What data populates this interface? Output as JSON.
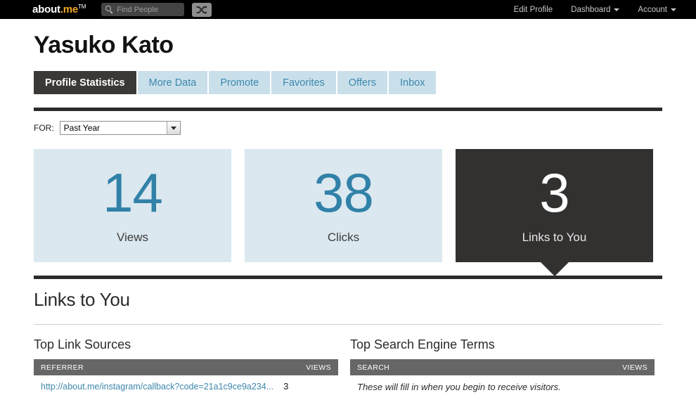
{
  "topbar": {
    "brand_name": "about",
    "brand_suffix": ".me",
    "brand_tm": "TM",
    "search_placeholder": "Find People",
    "shuffle_icon": "shuffle-icon",
    "nav": [
      {
        "label": "Edit Profile",
        "has_caret": false
      },
      {
        "label": "Dashboard",
        "has_caret": true
      },
      {
        "label": "Account",
        "has_caret": true
      }
    ]
  },
  "profile": {
    "name": "Yasuko Kato"
  },
  "tabs": [
    {
      "label": "Profile Statistics",
      "active": true
    },
    {
      "label": "More Data",
      "active": false
    },
    {
      "label": "Promote",
      "active": false
    },
    {
      "label": "Favorites",
      "active": false
    },
    {
      "label": "Offers",
      "active": false
    },
    {
      "label": "Inbox",
      "active": false
    }
  ],
  "filter": {
    "label": "FOR:",
    "selected": "Past Year",
    "options": [
      "Past Year"
    ]
  },
  "stats": [
    {
      "value": "14",
      "label": "Views",
      "theme": "light"
    },
    {
      "value": "38",
      "label": "Clicks",
      "theme": "light"
    },
    {
      "value": "3",
      "label": "Links to You",
      "theme": "dark"
    }
  ],
  "section": {
    "title": "Links to You"
  },
  "top_link_sources": {
    "title": "Top Link Sources",
    "columns": [
      "REFERRER",
      "VIEWS"
    ],
    "rows": [
      {
        "referrer": "http://about.me/instagram/callback?code=21a1c9ce9a234...",
        "views": "3"
      }
    ]
  },
  "top_search_terms": {
    "title": "Top Search Engine Terms",
    "columns": [
      "SEARCH",
      "VIEWS"
    ],
    "rows": [],
    "empty_message": "These will fill in when you begin to receive visitors."
  },
  "colors": {
    "accent_blue": "#3181a8",
    "link_blue": "#3d87ac",
    "card_light": "#dbe8ef",
    "card_dark": "#333130",
    "brand_orange": "#f0a52a",
    "table_header_gray": "#666666"
  }
}
